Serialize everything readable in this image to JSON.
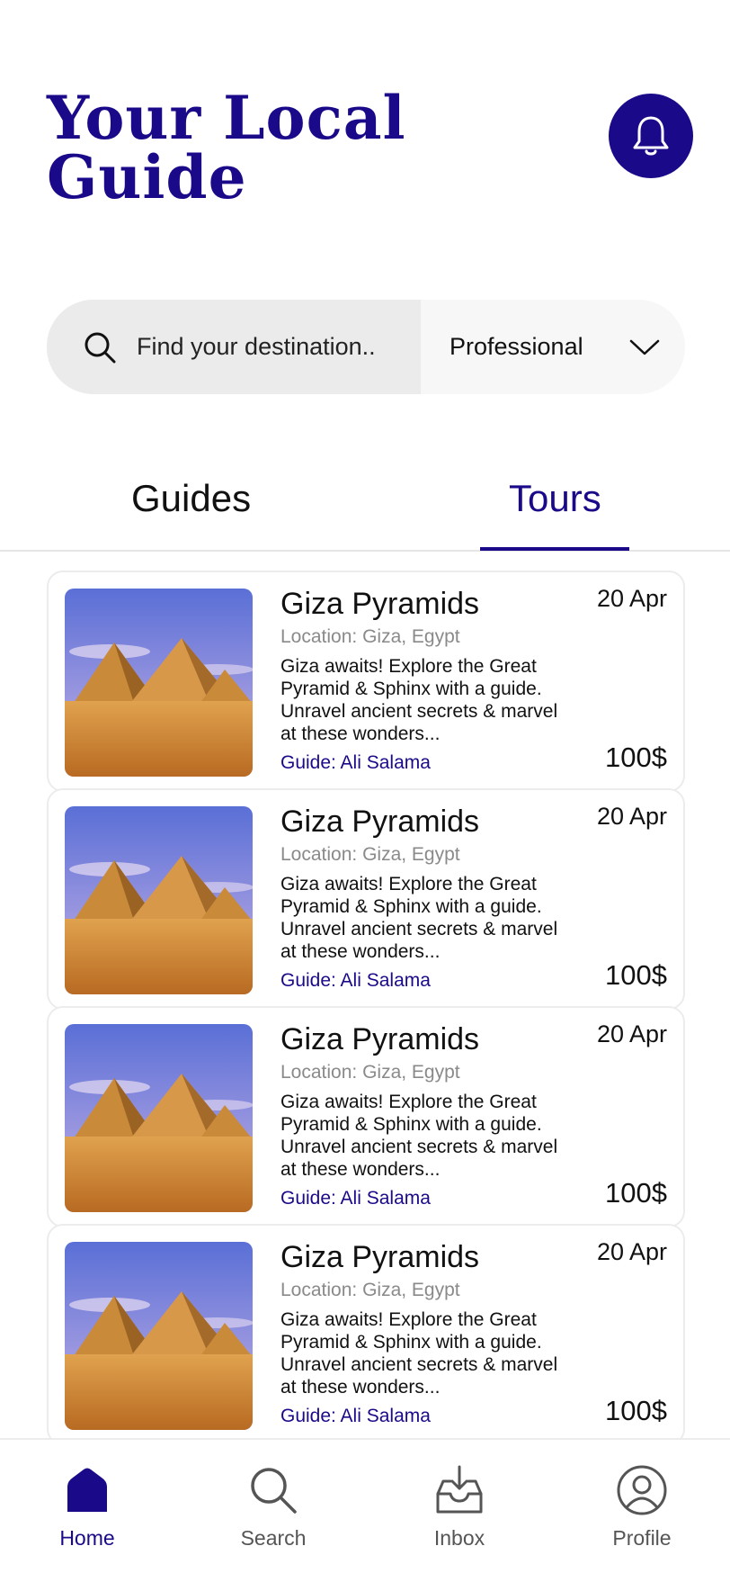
{
  "header": {
    "title_line1": "Your Local",
    "title_line2": "Guide"
  },
  "search": {
    "placeholder": "Find your destination..",
    "filter_value": "Professional"
  },
  "tabs": [
    {
      "label": "Guides",
      "active": false
    },
    {
      "label": "Tours",
      "active": true
    }
  ],
  "tours": [
    {
      "title": "Giza Pyramids",
      "date": "20 Apr",
      "location": "Location: Giza, Egypt",
      "description": "Giza awaits! Explore the Great Pyramid & Sphinx with a guide. Unravel ancient secrets & marvel at these wonders...",
      "guide": "Guide: Ali Salama",
      "price": "100$"
    },
    {
      "title": "Giza Pyramids",
      "date": "20 Apr",
      "location": "Location: Giza, Egypt",
      "description": "Giza awaits! Explore the Great Pyramid & Sphinx with a guide. Unravel ancient secrets & marvel at these wonders...",
      "guide": "Guide: Ali Salama",
      "price": "100$"
    },
    {
      "title": "Giza Pyramids",
      "date": "20 Apr",
      "location": "Location: Giza, Egypt",
      "description": "Giza awaits! Explore the Great Pyramid & Sphinx with a guide. Unravel ancient secrets & marvel at these wonders...",
      "guide": "Guide: Ali Salama",
      "price": "100$"
    },
    {
      "title": "Giza Pyramids",
      "date": "20 Apr",
      "location": "Location: Giza, Egypt",
      "description": "Giza awaits! Explore the Great Pyramid & Sphinx with a guide. Unravel ancient secrets & marvel at these wonders...",
      "guide": "Guide: Ali Salama",
      "price": "100$"
    }
  ],
  "nav": {
    "home": "Home",
    "search": "Search",
    "inbox": "Inbox",
    "profile": "Profile"
  },
  "colors": {
    "brand": "#1a0a8a",
    "muted": "#8a8a8a"
  },
  "icons": {
    "bell": "bell-icon",
    "search": "search-icon",
    "chevron": "chevron-down-icon",
    "home": "home-icon",
    "inbox": "inbox-icon",
    "profile": "profile-icon"
  }
}
